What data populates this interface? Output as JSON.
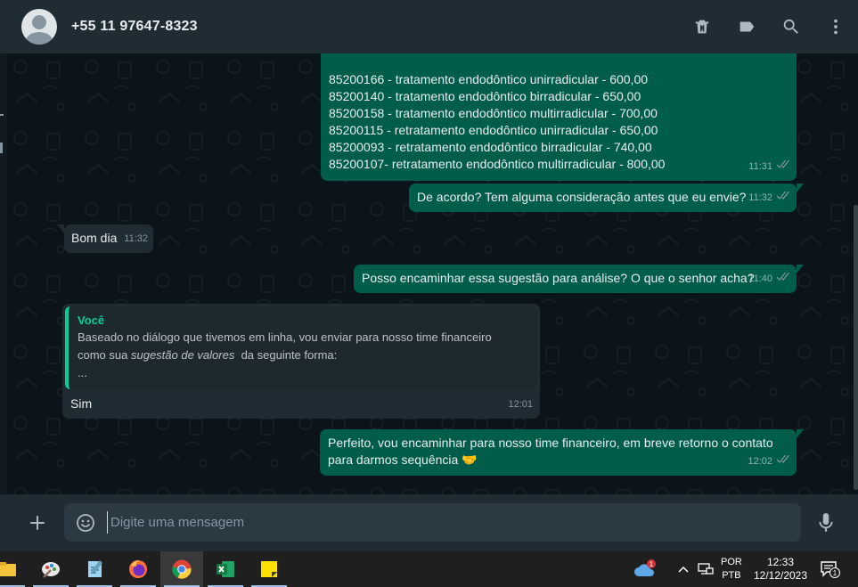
{
  "header": {
    "contact_name": "+55 11 97647-8323",
    "icons": [
      "trash-icon",
      "label-icon",
      "search-icon",
      "menu-dots-icon"
    ]
  },
  "messages": [
    {
      "direction": "out",
      "lines": [
        "85200166 - tratamento endodôntico unirradicular - 600,00",
        "85200140 - tratamento endodôntico birradicular  - 650,00",
        "85200158 - tratamento endodôntico multirradicular - 700,00",
        "85200115 - retratamento endodôntico unirradicular - 650,00",
        "85200093 - retratamento endodôntico birradicular - 740,00",
        "85200107- retratamento endodôntico multirradicular - 800,00"
      ],
      "time": "11:31",
      "status": "read"
    },
    {
      "direction": "out",
      "text": "De acordo? Tem alguma consideração antes que eu envie?",
      "time": "11:32",
      "status": "read"
    },
    {
      "direction": "in",
      "text": "Bom dia",
      "time": "11:32"
    },
    {
      "direction": "out",
      "text": "Posso encaminhar essa sugestão para análise? O que o senhor acha?",
      "time": "11:40",
      "status": "read"
    },
    {
      "direction": "in",
      "quote": {
        "author": "Você",
        "line1": "Baseado no diálogo que tivemos em linha, vou enviar para nosso time financeiro",
        "line2_start": "como sua ",
        "line2_italic": "sugestão de valores",
        "line2_end": "  da seguinte forma:",
        "line3": "..."
      },
      "text": "Sim",
      "time": "12:01"
    },
    {
      "direction": "out",
      "line1": "Perfeito, vou encaminhar para nosso time financeiro, em breve retorno o contato",
      "line2": "para darmos sequência 🤝",
      "time": "12:02",
      "status": "read"
    }
  ],
  "composer": {
    "placeholder": "Digite uma mensagem"
  },
  "taskbar": {
    "apps": [
      "file-explorer-icon",
      "paint-icon",
      "notepad-icon",
      "firefox-icon",
      "chrome-icon",
      "excel-icon",
      "sticky-notes-icon"
    ],
    "active_app": "chrome-icon",
    "weather_badge": "1",
    "lang_1": "POR",
    "lang_2": "PTB",
    "time": "12:33",
    "date": "12/12/2023",
    "notifications": "1"
  },
  "colors": {
    "outgoing_bubble": "#005c4b",
    "incoming_bubble": "#202c33",
    "accent": "#06cf9c",
    "read_ticks": "#53bdeb"
  }
}
